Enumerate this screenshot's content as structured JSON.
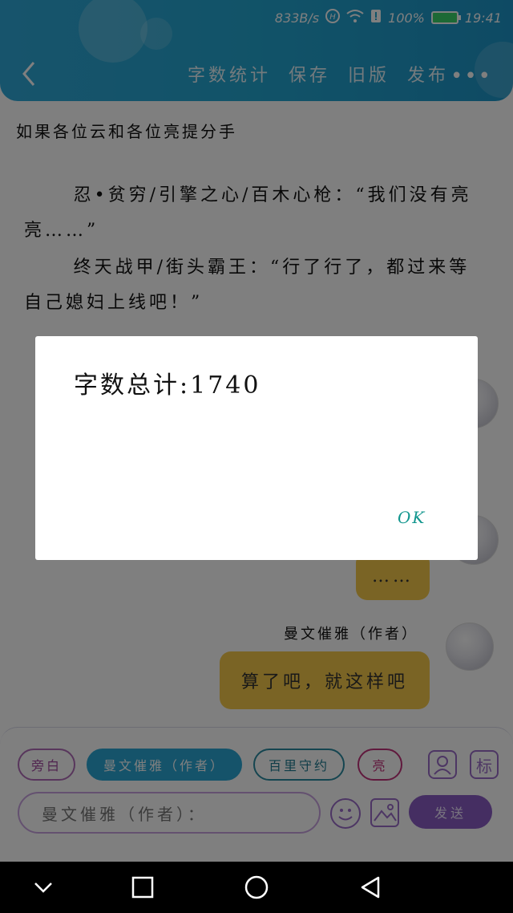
{
  "status_bar": {
    "speed": "833B/s",
    "battery_percent": "100%",
    "time": "19:41"
  },
  "header": {
    "nav": [
      "字数统计",
      "保存",
      "旧版",
      "发布"
    ],
    "more": "•••"
  },
  "content": {
    "title": "如果各位云和各位亮提分手",
    "paragraphs": [
      "忍•贫穷/引擎之心/百木心枪：“我们没有亮亮……”",
      "终天战甲/街头霸王：“行了行了，都过来等自己媳妇上线吧！”"
    ]
  },
  "chat": {
    "ellipsis_bubble": "……",
    "speaker": "曼文催雅（作者）",
    "message": "算了吧，就这样吧"
  },
  "composer": {
    "pills": {
      "aside": "旁白",
      "author": "曼文催雅（作者）",
      "baili": "百里守约",
      "liang": "亮"
    },
    "label_icon_text": "标",
    "input_placeholder": "曼文催雅（作者）：",
    "send": "发送"
  },
  "dialog": {
    "message": "字数总计:1740",
    "ok": "OK"
  },
  "colors": {
    "header": "#23a6d1",
    "bubble": "#f4c84a",
    "accent_purple": "#8b5dc4",
    "ok_teal": "#12968e"
  }
}
